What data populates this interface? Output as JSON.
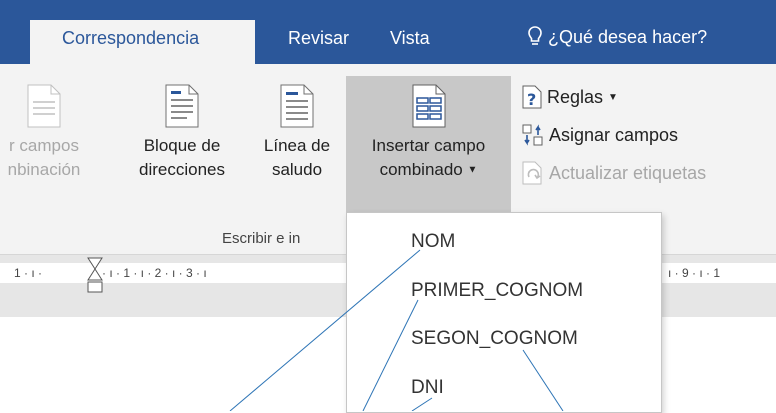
{
  "tabs": {
    "correspondencia": "Correspondencia",
    "revisar": "Revisar",
    "vista": "Vista",
    "tell_me": "¿Qué desea hacer?"
  },
  "ribbon": {
    "btn_campos": {
      "line1": "r campos",
      "line2": "nbinación"
    },
    "btn_bloque": {
      "line1": "Bloque de",
      "line2": "direcciones"
    },
    "btn_linea": {
      "line1": "Línea de",
      "line2": "saludo"
    },
    "btn_insertar": {
      "line1": "Insertar campo",
      "line2": "combinado"
    },
    "reglas": "Reglas",
    "asignar": "Asignar campos",
    "actualizar": "Actualizar etiquetas",
    "group_label": "Escribir e in"
  },
  "ruler": {
    "left": "1 · ı ·",
    "marks": "· ı · 1 · ı · 2 · ı · 3 · ı",
    "right": "ı · 9 · ı · 1"
  },
  "dropdown": {
    "items": [
      "NOM",
      "PRIMER_COGNOM",
      "SEGON_COGNOM",
      "DNI"
    ]
  },
  "colors": {
    "tabbar": "#2b579a",
    "ribbon": "#f3f3f3",
    "accent": "#2b579a",
    "callout_line": "#2e75b6"
  },
  "icons": [
    "lightbulb-icon",
    "document-icon",
    "insert-field-icon",
    "rules-icon",
    "match-fields-icon",
    "update-labels-icon"
  ]
}
